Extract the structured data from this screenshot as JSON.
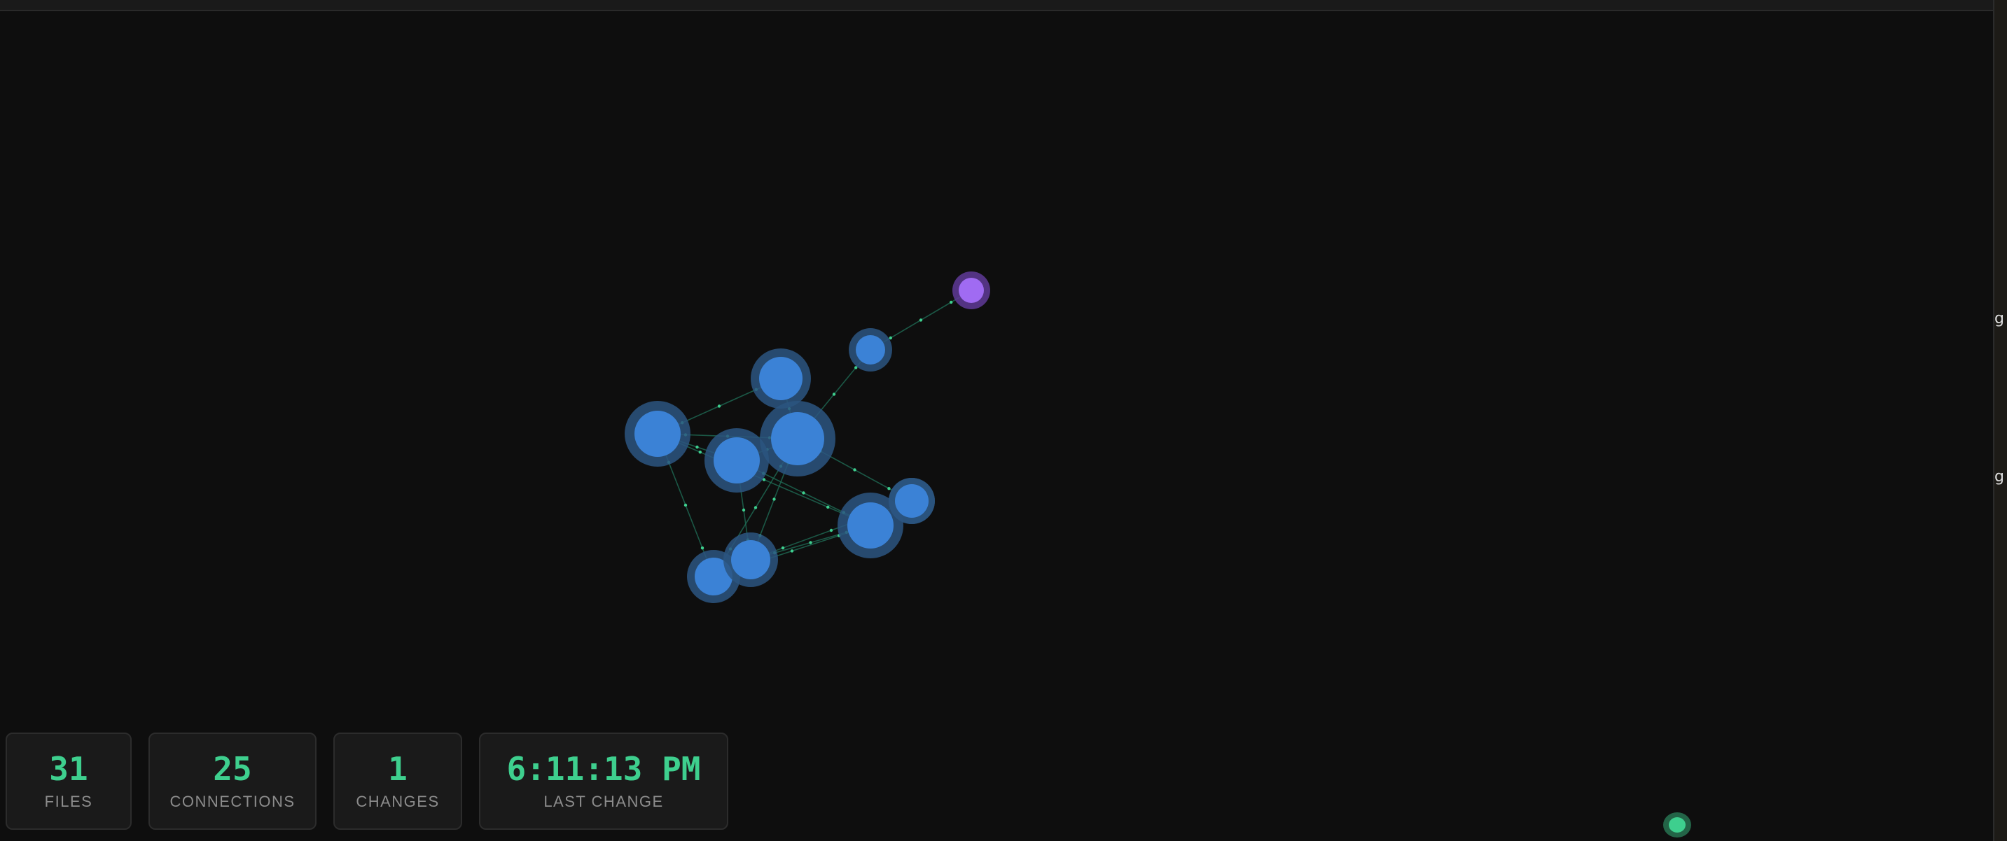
{
  "stats": {
    "files": {
      "value": "31",
      "label": "FILES"
    },
    "connections": {
      "value": "25",
      "label": "CONNECTIONS"
    },
    "changes": {
      "value": "1",
      "label": "CHANGES"
    },
    "last_change": {
      "value": "6:11:13 PM",
      "label": "LAST CHANGE"
    }
  },
  "colors": {
    "background": "#0e0e0e",
    "node_file": "#3b82d6",
    "node_file_halo": "#2b5580",
    "node_highlight": "#a06bf2",
    "node_highlight_halo": "#5f3a98",
    "edge": "#1f6b55",
    "edge_particle": "#3ecf8e",
    "accent": "#3ecf8e",
    "label": "#8c8c8c"
  },
  "right_edge_glyphs": [
    "g",
    "g"
  ],
  "graph": {
    "nodes": [
      {
        "id": "n0",
        "kind": "file"
      },
      {
        "id": "n1",
        "kind": "file"
      },
      {
        "id": "n2",
        "kind": "file"
      },
      {
        "id": "n3",
        "kind": "file"
      },
      {
        "id": "n4",
        "kind": "file"
      },
      {
        "id": "n5",
        "kind": "file"
      },
      {
        "id": "n6",
        "kind": "file"
      },
      {
        "id": "n7",
        "kind": "file"
      },
      {
        "id": "n8",
        "kind": "file"
      },
      {
        "id": "n9",
        "kind": "file"
      },
      {
        "id": "n10",
        "kind": "highlight"
      }
    ],
    "edges": [
      [
        "n10",
        "n9"
      ],
      [
        "n9",
        "n2"
      ],
      [
        "n1",
        "n0"
      ],
      [
        "n1",
        "n2"
      ],
      [
        "n0",
        "n3"
      ],
      [
        "n0",
        "n2"
      ],
      [
        "n3",
        "n2"
      ],
      [
        "n0",
        "n5"
      ],
      [
        "n0",
        "n6"
      ],
      [
        "n3",
        "n5"
      ],
      [
        "n2",
        "n6"
      ],
      [
        "n3",
        "n7"
      ],
      [
        "n2",
        "n7"
      ],
      [
        "n2",
        "n8"
      ],
      [
        "n7",
        "n8"
      ],
      [
        "n7",
        "n5"
      ],
      [
        "n5",
        "n6"
      ]
    ]
  }
}
